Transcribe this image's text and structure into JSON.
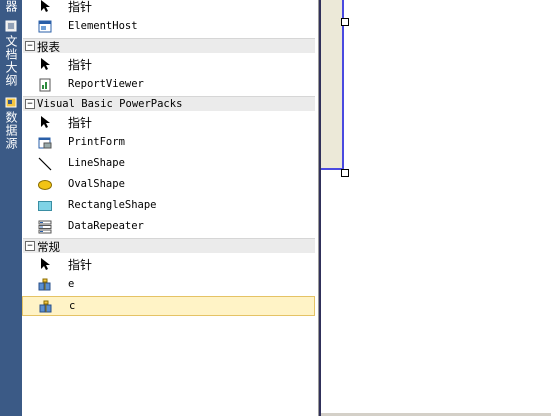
{
  "side_tabs": [
    {
      "label": "器"
    },
    {
      "label": "文档大纲"
    },
    {
      "label": "数据源"
    }
  ],
  "toolbox": {
    "top_items": [
      {
        "label": "指针",
        "icon": "pointer-icon"
      },
      {
        "label": "ElementHost",
        "icon": "elementhost-icon"
      }
    ],
    "categories": [
      {
        "name": "报表",
        "toggle": "−",
        "items": [
          {
            "label": "指针",
            "icon": "pointer-icon"
          },
          {
            "label": "ReportViewer",
            "icon": "reportviewer-icon"
          }
        ]
      },
      {
        "name": "Visual Basic PowerPacks",
        "toggle": "−",
        "items": [
          {
            "label": "指针",
            "icon": "pointer-icon"
          },
          {
            "label": "PrintForm",
            "icon": "printform-icon"
          },
          {
            "label": "LineShape",
            "icon": "lineshape-icon"
          },
          {
            "label": "OvalShape",
            "icon": "ovalshape-icon"
          },
          {
            "label": "RectangleShape",
            "icon": "rectangleshape-icon"
          },
          {
            "label": "DataRepeater",
            "icon": "datarepeater-icon"
          }
        ]
      },
      {
        "name": "常规",
        "toggle": "−",
        "items": [
          {
            "label": "指针",
            "icon": "pointer-icon"
          },
          {
            "label": "e",
            "icon": "component-icon"
          },
          {
            "label": "c",
            "icon": "component-icon",
            "selected": true
          }
        ]
      }
    ]
  },
  "colors": {
    "selection_bg": "#fff3c6",
    "selection_border": "#e5c365",
    "side_strip": "#3b5a86",
    "form_border": "#4a4ae0"
  }
}
